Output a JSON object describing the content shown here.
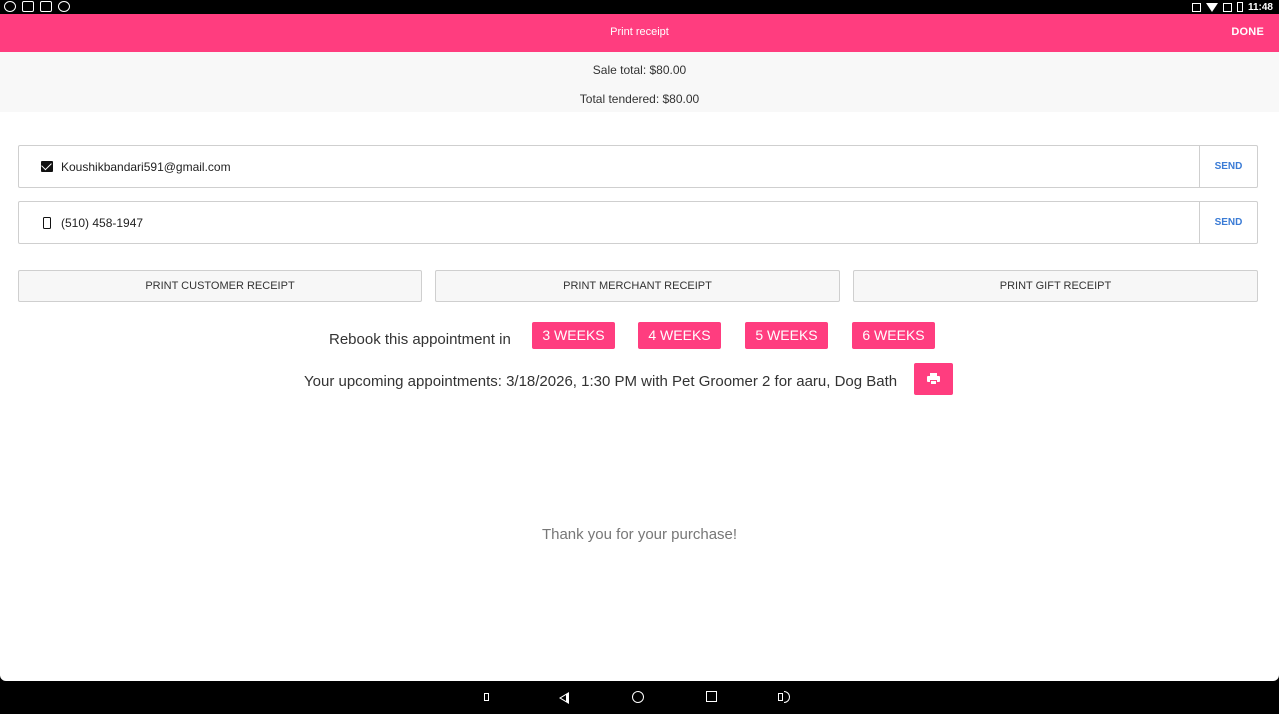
{
  "status_bar": {
    "time": "11:48"
  },
  "app_bar": {
    "title": "Print receipt",
    "done_label": "DONE"
  },
  "totals": {
    "sale_total": "Sale total: $80.00",
    "total_tendered": "Total tendered: $80.00"
  },
  "email": {
    "value": "Koushikbandari591@gmail.com",
    "send_label": "SEND",
    "icon": "email-icon"
  },
  "phone": {
    "value": "(510) 458-1947",
    "send_label": "SEND",
    "icon": "phone-icon"
  },
  "print_buttons": {
    "customer": "PRINT CUSTOMER RECEIPT",
    "merchant": "PRINT MERCHANT RECEIPT",
    "gift": "PRINT GIFT RECEIPT"
  },
  "rebook": {
    "label": "Rebook this appointment in",
    "options": [
      "3 WEEKS",
      "4 WEEKS",
      "5 WEEKS",
      "6 WEEKS"
    ]
  },
  "upcoming": {
    "text": "Your upcoming appointments: 3/18/2026, 1:30 PM with Pet Groomer 2 for aaru, Dog Bath",
    "print_icon": "printer-icon"
  },
  "thanks": "Thank you for your purchase!",
  "colors": {
    "accent": "#ff3d7f",
    "link": "#3a7bd5"
  }
}
